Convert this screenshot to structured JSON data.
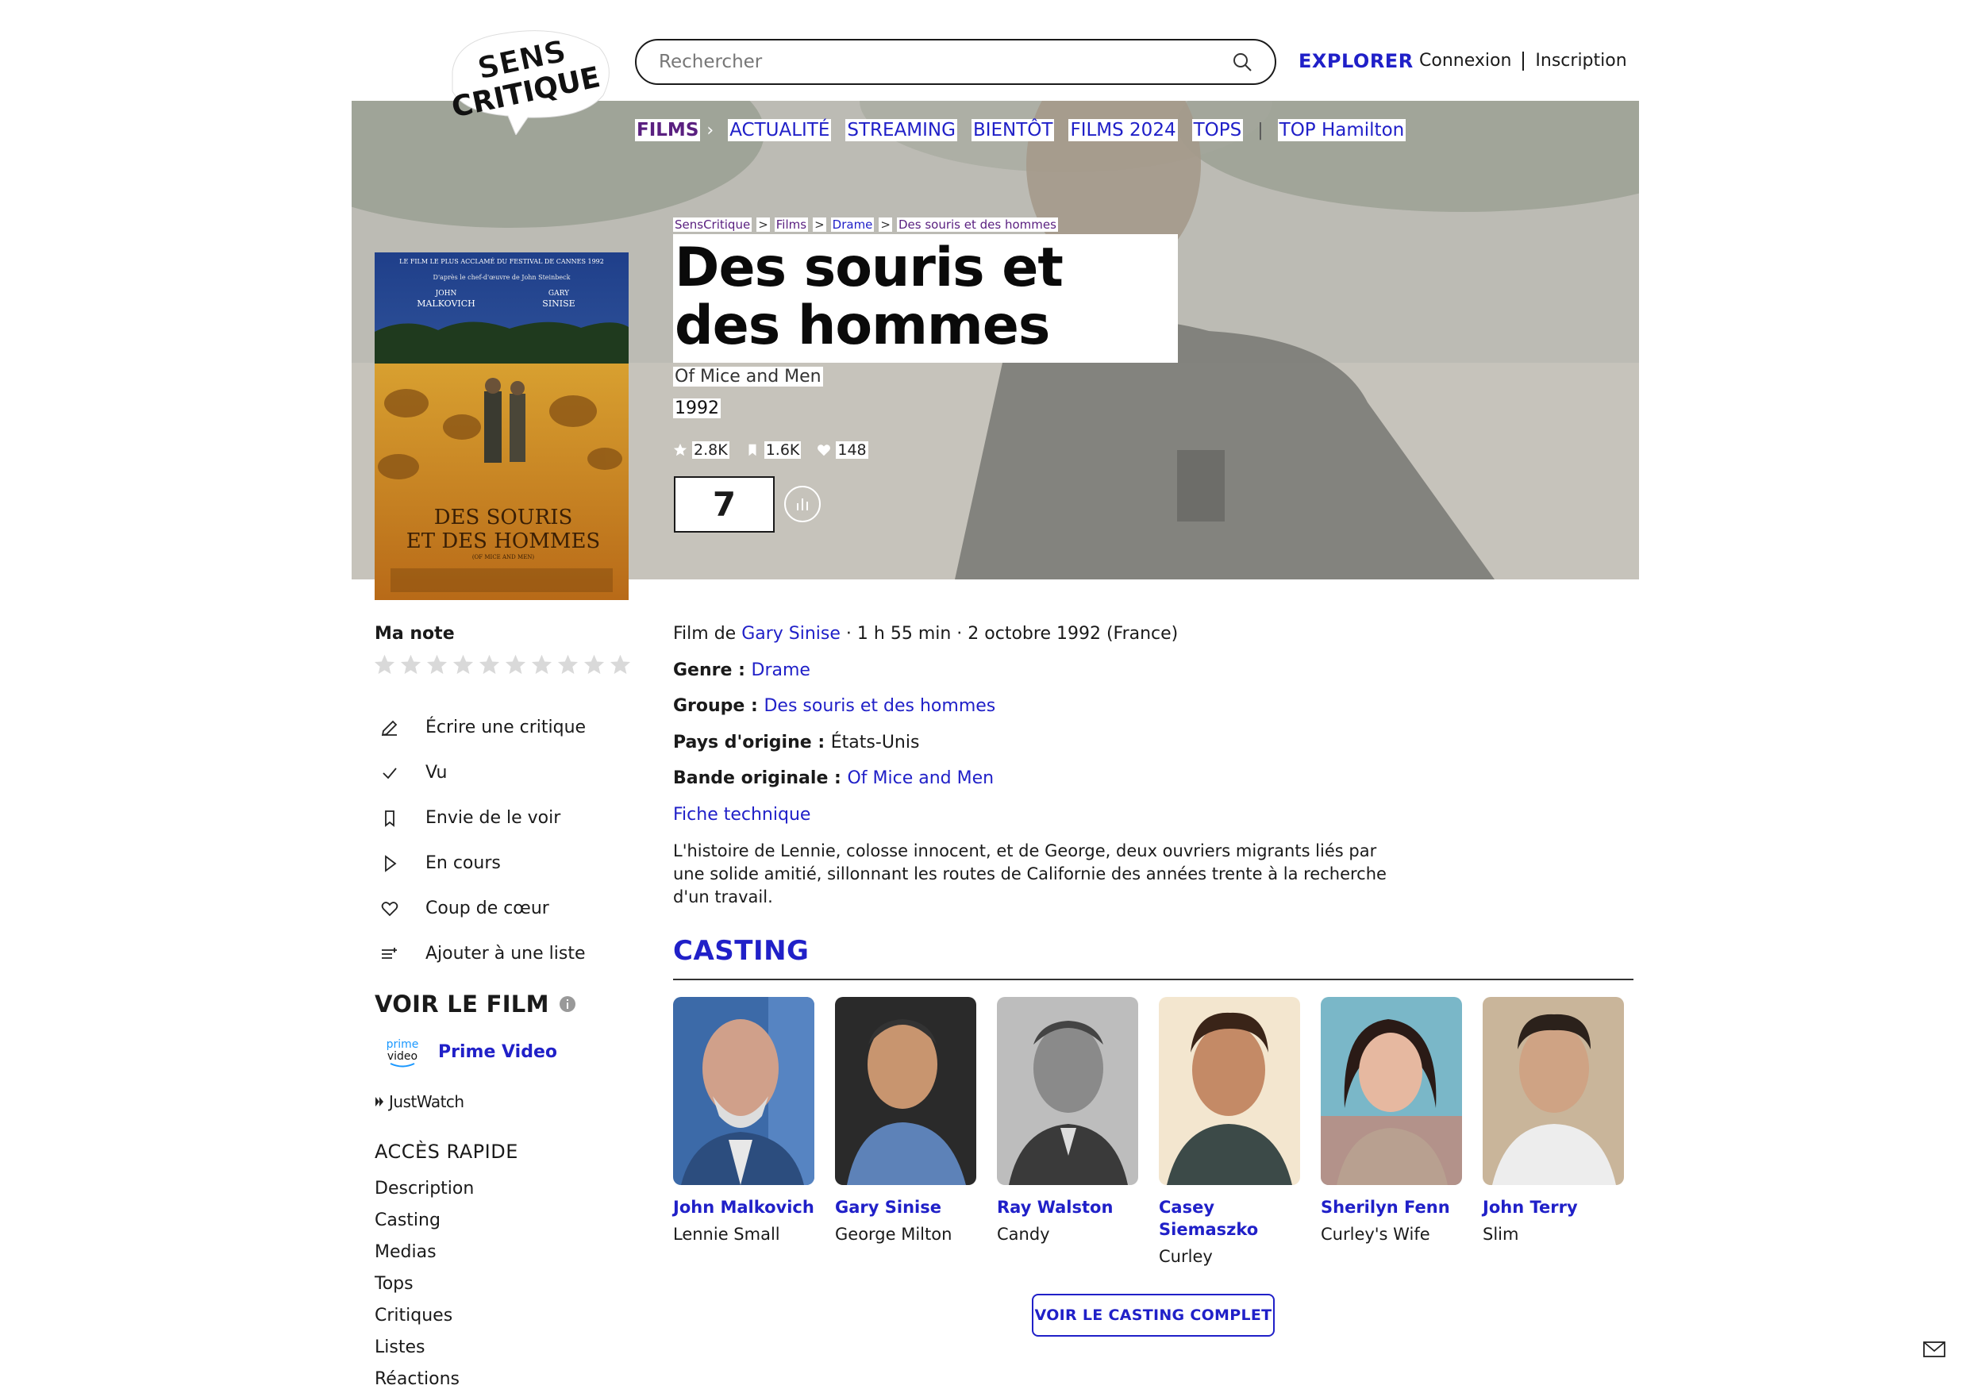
{
  "header": {
    "logo_text_line1": "SENS",
    "logo_text_line2": "CRITIQUE",
    "search_placeholder": "Rechercher",
    "explorer": "EXPLORER",
    "login": "Connexion",
    "signup": "Inscription"
  },
  "nav": {
    "films": "FILMS",
    "items": [
      "ACTUALITÉ",
      "STREAMING",
      "BIENTÔT",
      "FILMS 2024",
      "TOPS"
    ],
    "top": "TOP Hamilton"
  },
  "breadcrumb": [
    "SensCritique",
    "Films",
    "Drame",
    "Des souris et des hommes"
  ],
  "movie": {
    "title": "Des souris et des hommes",
    "original_title": "Of Mice and Men",
    "year": "1992",
    "ratings_count": "2.8K",
    "wishlist_count": "1.6K",
    "favorites_count": "148",
    "score": "7"
  },
  "poster": {
    "line1": "LE FILM LE PLUS ACCLAMÉ DU FESTIVAL DE CANNES 1992",
    "line2": "D'après le chef-d'œuvre de John Steinbeck",
    "actor1_first": "JOHN",
    "actor1_last": "MALKOVICH",
    "actor2_first": "GARY",
    "actor2_last": "SINISE",
    "title1": "DES SOURIS",
    "title2": "ET DES HOMMES",
    "subtitle": "(OF MICE AND MEN)"
  },
  "sidebar": {
    "my_rating": "Ma note",
    "star_count": 10,
    "actions": [
      {
        "label": "Écrire une critique",
        "icon": "pencil-icon"
      },
      {
        "label": "Vu",
        "icon": "check-icon"
      },
      {
        "label": "Envie de le voir",
        "icon": "bookmark-icon"
      },
      {
        "label": "En cours",
        "icon": "play-icon"
      },
      {
        "label": "Coup de cœur",
        "icon": "heart-icon"
      },
      {
        "label": "Ajouter à une liste",
        "icon": "list-add-icon"
      }
    ],
    "watch_title": "VOIR LE FILM",
    "provider_logo_top": "prime",
    "provider_logo_bottom": "video",
    "provider": "Prime Video",
    "justwatch": "JustWatch",
    "quick_access_title": "ACCÈS RAPIDE",
    "quick_access": [
      "Description",
      "Casting",
      "Medias",
      "Tops",
      "Critiques",
      "Listes",
      "Réactions"
    ]
  },
  "info": {
    "film_by_prefix": "Film de ",
    "director": "Gary Sinise",
    "duration_release": " · 1 h 55 min · 2 octobre 1992 (France)",
    "genre_label": "Genre : ",
    "genre": "Drame",
    "group_label": "Groupe : ",
    "group": "Des souris et des hommes",
    "country_label": "Pays d'origine : ",
    "country": "États-Unis",
    "soundtrack_label": "Bande originale : ",
    "soundtrack": "Of Mice and Men",
    "tech_sheet": "Fiche technique",
    "synopsis": "L'histoire de Lennie, colosse innocent, et de George, deux ouvriers migrants liés par une solide amitié, sillonnant les routes de Californie des années trente à la recherche d'un travail."
  },
  "casting": {
    "title": "CASTING",
    "members": [
      {
        "actor": "John Malkovich",
        "role": "Lennie Small"
      },
      {
        "actor": "Gary Sinise",
        "role": "George Milton"
      },
      {
        "actor": "Ray Walston",
        "role": "Candy"
      },
      {
        "actor": "Casey Siemaszko",
        "role": "Curley"
      },
      {
        "actor": "Sherilyn Fenn",
        "role": "Curley's Wife"
      },
      {
        "actor": "John Terry",
        "role": "Slim"
      }
    ],
    "full_cast_button": "VOIR LE CASTING COMPLET"
  },
  "colors": {
    "accent_blue": "#2020c8",
    "films_purple": "#5a2080"
  }
}
